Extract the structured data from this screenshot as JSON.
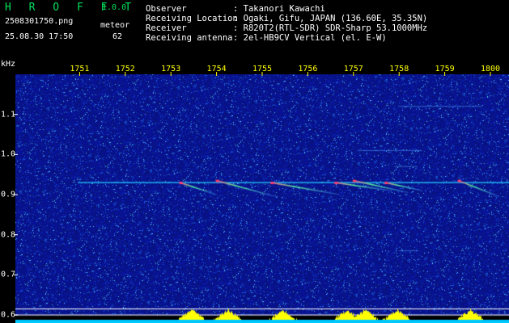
{
  "app": {
    "name": "H R O F F T",
    "version": "1.0.0"
  },
  "file": {
    "name": "2508301750.png",
    "datetime": "25.08.30 17:50"
  },
  "counter": {
    "label": "meteor",
    "value": "62"
  },
  "station_info": [
    {
      "label": "Observer",
      "value": ": Takanori Kawachi"
    },
    {
      "label": "Receiving Location",
      "value": ": Ogaki, Gifu, JAPAN (136.60E, 35.35N)"
    },
    {
      "label": "Receiver",
      "value": ": R820T2(RTL-SDR) SDR-Sharp 53.1000MHz"
    },
    {
      "label": "Receiving antenna",
      "value": ": 2el-HB9CV Vertical (el. E-W)"
    }
  ],
  "colors": {
    "app_green": "#00e05a",
    "time_labels": "#ffff00",
    "background_noise": "#0a1a8c",
    "carrier": "#20d0ff",
    "level_bars": "#ffff00",
    "level_base": "#00c8ff"
  },
  "chart_data": {
    "type": "heatmap",
    "ylabel": "kHz",
    "x_ticks": [
      "1751",
      "1752",
      "1753",
      "1754",
      "1755",
      "1756",
      "1757",
      "1758",
      "1759",
      "1800"
    ],
    "y_ticks": [
      "1.1",
      "1.0",
      "0.9",
      "0.8",
      "0.7",
      "0.6"
    ],
    "xlim": [
      "1750",
      "1800"
    ],
    "ylim": [
      0.58,
      1.2
    ],
    "grid": false,
    "carrier_khz": 0.93,
    "meteor_echoes": [
      {
        "time": 1753.2,
        "khz": 0.93,
        "dur_min": 0.8,
        "drift_khz": -0.03
      },
      {
        "time": 1754.0,
        "khz": 0.935,
        "dur_min": 1.3,
        "drift_khz": -0.04
      },
      {
        "time": 1755.2,
        "khz": 0.93,
        "dur_min": 1.5,
        "drift_khz": -0.03
      },
      {
        "time": 1756.6,
        "khz": 0.93,
        "dur_min": 1.2,
        "drift_khz": -0.02
      },
      {
        "time": 1757.0,
        "khz": 0.935,
        "dur_min": 1.2,
        "drift_khz": -0.03
      },
      {
        "time": 1757.7,
        "khz": 0.93,
        "dur_min": 0.8,
        "drift_khz": -0.02
      },
      {
        "time": 1759.3,
        "khz": 0.935,
        "dur_min": 0.9,
        "drift_khz": -0.04
      }
    ]
  }
}
